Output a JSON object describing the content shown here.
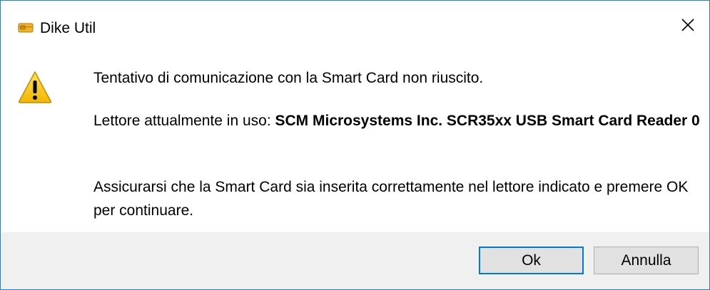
{
  "window": {
    "title": "Dike Util",
    "app_icon": "smartcard-icon",
    "close_icon": "close-icon"
  },
  "message": {
    "icon": "warning-icon",
    "line1": "Tentativo di comunicazione con la Smart Card non riuscito.",
    "reader_prefix": "Lettore attualmente in uso: ",
    "reader_name": "SCM Microsystems Inc. SCR35xx USB Smart Card Reader 0",
    "instructions": "Assicurarsi che la Smart Card sia inserita correttamente nel lettore indicato e premere OK per continuare."
  },
  "buttons": {
    "ok_label": "Ok",
    "cancel_label": "Annulla"
  },
  "colors": {
    "window_border": "#1883d7",
    "footer_bg": "#f0f0f0",
    "default_button_border": "#0078d7",
    "warning_yellow": "#f7c800"
  }
}
